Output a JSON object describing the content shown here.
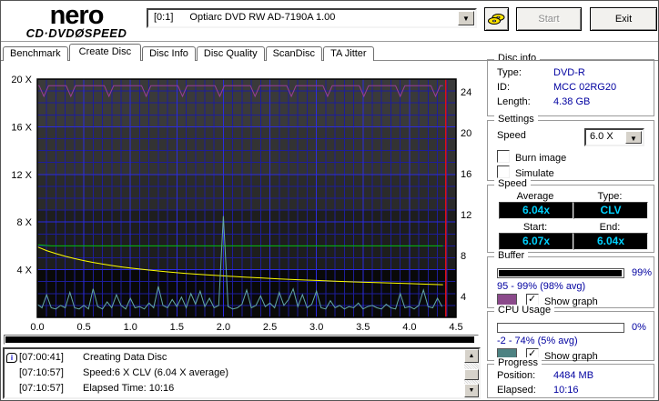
{
  "colors": {
    "value_text": "#0000a0",
    "lcd_text": "#00d2ff",
    "buffer_swatch": "#8b4a8b",
    "cpu_swatch": "#4d8282",
    "write_speed_line": "#00c400",
    "rotation_speed_line": "#ffff00",
    "cpu_line": "#63a8a8",
    "buffer_line": "#993d99",
    "position_line": "#e01010"
  },
  "topbar": {
    "brand": "nero",
    "product_prefix": "CD·DVD",
    "product_disc_glyph": "Ø",
    "product_suffix": "SPEED",
    "drive_bus": "[0:1]",
    "drive_name": "Optiarc DVD RW AD-7190A 1.00",
    "start_label": "Start",
    "exit_label": "Exit"
  },
  "tabs": {
    "active_index": 1,
    "items": [
      "Benchmark",
      "Create Disc",
      "Disc Info",
      "Disc Quality",
      "ScanDisc",
      "TA Jitter"
    ]
  },
  "chart_data": {
    "type": "line",
    "x_unit": "GB",
    "x_range": [
      0,
      4.5
    ],
    "y_left_range_x": [
      0,
      20
    ],
    "x_ticks": [
      {
        "label": "0.0",
        "value": 0
      },
      {
        "label": "0.5",
        "value": 0.5
      },
      {
        "label": "1.0",
        "value": 1.0
      },
      {
        "label": "1.5",
        "value": 1.5
      },
      {
        "label": "2.0",
        "value": 2.0
      },
      {
        "label": "2.5",
        "value": 2.5
      },
      {
        "label": "3.0",
        "value": 3.0
      },
      {
        "label": "3.5",
        "value": 3.5
      },
      {
        "label": "4.0",
        "value": 4.0
      },
      {
        "label": "4.5",
        "value": 4.5
      }
    ],
    "left_ticks": [
      {
        "label": "20 X",
        "value": 20
      },
      {
        "label": "16 X",
        "value": 16
      },
      {
        "label": "12 X",
        "value": 12
      },
      {
        "label": "8 X",
        "value": 8
      },
      {
        "label": "4 X",
        "value": 4
      }
    ],
    "right_ticks": [
      {
        "label": "24",
        "value": 24
      },
      {
        "label": "20",
        "value": 20
      },
      {
        "label": "16",
        "value": 16
      },
      {
        "label": "12",
        "value": 12
      },
      {
        "label": "8",
        "value": 8
      },
      {
        "label": "4",
        "value": 4
      }
    ],
    "series": [
      {
        "name": "buffer-level",
        "kind": "notched",
        "base": 19.45,
        "dip": 18.55,
        "dip_half_width": 0.05,
        "x_end": 4.36,
        "dips": [
          0.07,
          0.36,
          0.77,
          1.17,
          1.56,
          1.96,
          2.34,
          2.73,
          3.12,
          3.51,
          3.9,
          4.28
        ]
      },
      {
        "name": "write-speed",
        "kind": "points",
        "points": [
          [
            0,
            6.1
          ],
          [
            0.15,
            6.0
          ],
          [
            4.36,
            6.0
          ]
        ]
      },
      {
        "name": "rotation-speed",
        "kind": "points",
        "points": [
          [
            0,
            5.92
          ],
          [
            0.1,
            5.6
          ],
          [
            0.2,
            5.35
          ],
          [
            0.3,
            5.12
          ],
          [
            0.4,
            4.93
          ],
          [
            0.5,
            4.76
          ],
          [
            0.6,
            4.61
          ],
          [
            0.7,
            4.47
          ],
          [
            0.8,
            4.35
          ],
          [
            0.9,
            4.24
          ],
          [
            1.0,
            4.14
          ],
          [
            1.2,
            3.97
          ],
          [
            1.4,
            3.82
          ],
          [
            1.6,
            3.69
          ],
          [
            1.8,
            3.58
          ],
          [
            2.0,
            3.48
          ],
          [
            2.2,
            3.39
          ],
          [
            2.4,
            3.31
          ],
          [
            2.6,
            3.23
          ],
          [
            2.8,
            3.16
          ],
          [
            3.0,
            3.1
          ],
          [
            3.2,
            3.04
          ],
          [
            3.4,
            2.98
          ],
          [
            3.6,
            2.93
          ],
          [
            3.8,
            2.88
          ],
          [
            4.0,
            2.83
          ],
          [
            4.2,
            2.78
          ],
          [
            4.36,
            2.74
          ]
        ]
      },
      {
        "name": "cpu-usage",
        "kind": "sampled",
        "x_step": 0.05,
        "values": [
          1.1,
          0.8,
          1.9,
          0.8,
          0.7,
          1.0,
          0.8,
          2.1,
          0.8,
          0.7,
          1.0,
          0.7,
          2.4,
          0.9,
          0.7,
          1.3,
          0.8,
          1.9,
          1.0,
          0.7,
          1.6,
          0.8,
          0.9,
          0.7,
          1.2,
          0.8,
          2.6,
          1.0,
          0.8,
          1.5,
          0.9,
          1.7,
          0.8,
          2.0,
          1.1,
          2.2,
          0.9,
          1.6,
          0.8,
          1.0,
          8.5,
          0.9,
          0.7,
          0.8,
          1.1,
          2.3,
          0.8,
          1.0,
          1.8,
          0.9,
          1.2,
          0.8,
          2.1,
          1.0,
          1.5,
          2.4,
          0.9,
          1.9,
          0.8,
          1.1,
          2.2,
          0.8,
          0.7,
          1.4,
          0.8,
          1.0,
          0.7,
          0.9,
          0.8,
          1.2,
          0.7,
          0.9,
          1.0,
          0.8,
          0.7,
          1.1,
          0.8,
          0.7,
          2.0,
          0.8,
          0.9,
          0.7,
          1.0,
          2.3,
          0.9,
          0.8,
          1.6,
          0.9
        ]
      },
      {
        "name": "position-marker",
        "kind": "vline",
        "x": 4.39
      }
    ]
  },
  "sidebar": {
    "disc_info": {
      "title": "Disc info",
      "rows": [
        {
          "label": "Type:",
          "value": "DVD-R"
        },
        {
          "label": "ID:",
          "value": "MCC 02RG20"
        },
        {
          "label": "Length:",
          "value": "4.38 GB"
        }
      ]
    },
    "settings": {
      "title": "Settings",
      "speed_label": "Speed",
      "speed_value": "6.0 X",
      "checkboxes": [
        {
          "label": "Burn image",
          "checked": false
        },
        {
          "label": "Simulate",
          "checked": false
        }
      ]
    },
    "speed": {
      "title": "Speed",
      "cells": [
        {
          "label": "Average",
          "value": "6.04x"
        },
        {
          "label": "Type:",
          "value": "CLV"
        },
        {
          "label": "Start:",
          "value": "6.07x"
        },
        {
          "label": "End:",
          "value": "6.04x"
        }
      ]
    },
    "buffer": {
      "title": "Buffer",
      "bar_percent": 99,
      "bar_label": "99%",
      "range_text": "95 - 99% (98% avg)",
      "show_graph_label": "Show graph",
      "show_graph_checked": true
    },
    "cpu": {
      "title": "CPU Usage",
      "bar_percent": 0,
      "bar_label": "0%",
      "range_text": "-2 - 74% (5% avg)",
      "show_graph_label": "Show graph",
      "show_graph_checked": true
    },
    "progress": {
      "title": "Progress",
      "rows": [
        {
          "label": "Position:",
          "value": "4484 MB"
        },
        {
          "label": "Elapsed:",
          "value": "10:16"
        }
      ]
    }
  },
  "write_progress_bar": {
    "percent": 99.5
  },
  "log": {
    "entries": [
      {
        "time": "[07:00:41]",
        "text": "Creating Data Disc",
        "has_icon": true
      },
      {
        "time": "[07:10:57]",
        "text": "Speed:6 X CLV (6.04 X average)",
        "has_icon": false
      },
      {
        "time": "[07:10:57]",
        "text": "Elapsed Time: 10:16",
        "has_icon": false
      }
    ]
  }
}
